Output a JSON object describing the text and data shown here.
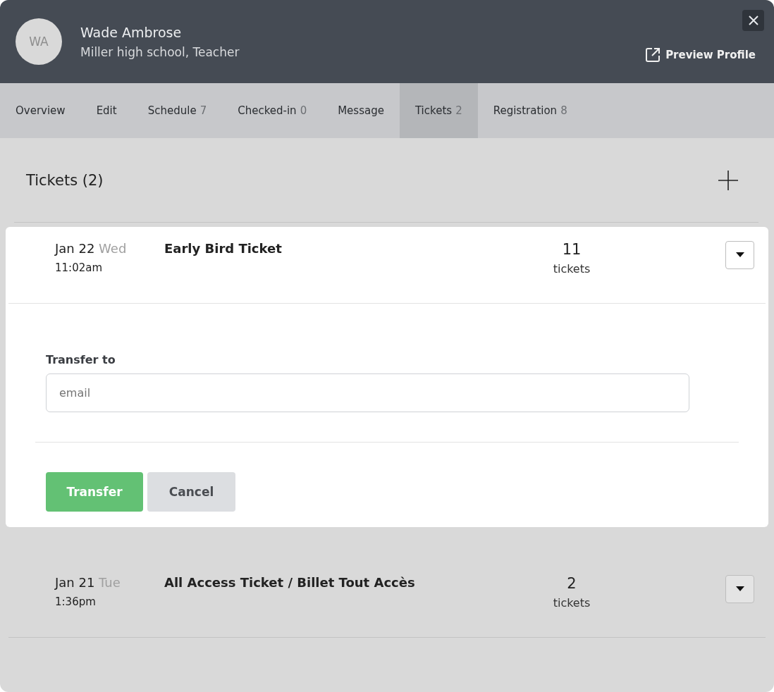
{
  "profile": {
    "initials": "WA",
    "name": "Wade Ambrose",
    "subtitle": "Miller high school, Teacher",
    "preview_link": "Preview Profile"
  },
  "tabs": [
    {
      "label": "Overview",
      "selected": false
    },
    {
      "label": "Edit",
      "selected": false
    },
    {
      "label": "Schedule",
      "count": "7",
      "selected": false
    },
    {
      "label": "Checked-in",
      "count": "0",
      "selected": false
    },
    {
      "label": "Message",
      "selected": false
    },
    {
      "label": "Tickets",
      "count": "2",
      "selected": true
    },
    {
      "label": "Registration",
      "count": "8",
      "selected": false
    }
  ],
  "section": {
    "title": "Tickets (2)"
  },
  "tickets": [
    {
      "date": "Jan 22",
      "weekday": "Wed",
      "time": "11:02am",
      "name": "Early Bird Ticket",
      "count": "11",
      "unit": "tickets",
      "expanded": true
    },
    {
      "date": "Jan 21",
      "weekday": "Tue",
      "time": "1:36pm",
      "name": "All Access Ticket / Billet Tout Accès",
      "count": "2",
      "unit": "tickets",
      "expanded": false
    }
  ],
  "transfer_form": {
    "label": "Transfer to",
    "placeholder": "email",
    "submit": "Transfer",
    "cancel": "Cancel"
  }
}
